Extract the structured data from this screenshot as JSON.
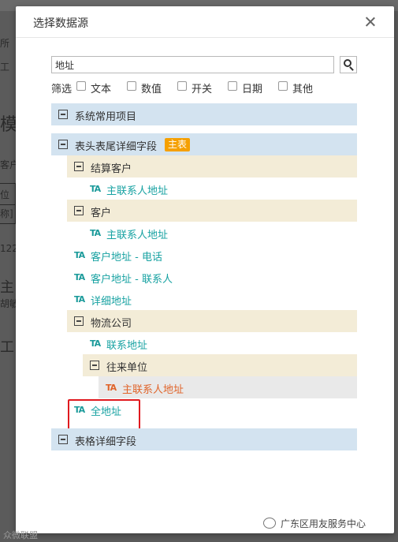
{
  "background": {
    "fragments": [
      "所",
      "工",
      "模",
      "客户",
      "位",
      "称]",
      "122",
      "胡敏",
      "主",
      "工"
    ]
  },
  "dialog": {
    "title": "选择数据源",
    "search": {
      "value": "地址",
      "placeholder": ""
    },
    "filters": {
      "label": "筛选",
      "options": [
        {
          "label": "文本",
          "checked": false
        },
        {
          "label": "数值",
          "checked": false
        },
        {
          "label": "开关",
          "checked": false
        },
        {
          "label": "日期",
          "checked": false
        },
        {
          "label": "其他",
          "checked": false
        }
      ]
    },
    "tree": {
      "group1": {
        "label": "系统常用项目"
      },
      "group2": {
        "label": "表头表尾详细字段",
        "badge": "主表",
        "settlement_customer": {
          "label": "结算客户",
          "leaf": "主联系人地址"
        },
        "customer": {
          "label": "客户",
          "leaf": "主联系人地址"
        },
        "leaf_customer_phone": "客户地址 - 电话",
        "leaf_customer_contact": "客户地址 - 联系人",
        "leaf_detail_address": "详细地址",
        "logistics": {
          "label": "物流公司",
          "leaf": "联系地址",
          "partner": {
            "label": "往来单位",
            "leaf": "主联系人地址"
          }
        },
        "leaf_full_address": "全地址"
      },
      "group3": {
        "label": "表格详细字段"
      }
    },
    "leaf_icon_text": "TA"
  },
  "watermark": {
    "text": "广东区用友服务中心"
  },
  "bottom_mark": "众微联盟",
  "colors": {
    "accent_teal": "#17a2a2",
    "selected_orange": "#e0642a",
    "badge_orange": "#f5a000",
    "group_blue": "#d3e3f0",
    "subgroup_beige": "#f3ecd7",
    "highlight_red": "#e0191e"
  },
  "icons": [
    "close-icon",
    "search-icon",
    "collapse-icon",
    "text-field-icon",
    "wechat-icon"
  ]
}
